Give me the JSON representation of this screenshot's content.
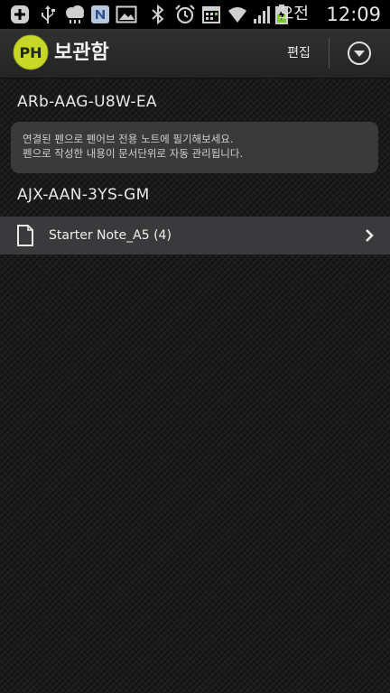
{
  "status_bar": {
    "ampm": "오전",
    "time": "12:09",
    "icons": [
      "add-icon",
      "usb-icon",
      "weather-icon",
      "n-app-icon",
      "gallery-icon",
      "bluetooth-icon",
      "alarm-icon",
      "calendar-icon",
      "wifi-icon",
      "signal-icon",
      "battery-charging-icon"
    ]
  },
  "action_bar": {
    "logo_text": "PH",
    "title": "보관함",
    "edit_label": "편집",
    "menu_icon": "dropdown-circle-icon"
  },
  "devices": [
    {
      "id_label": "ARb-AAG-U8W-EA",
      "hint_lines": [
        "연결된 펜으로 펜어브 전용 노트에 필기해보세요.",
        "펜으로 작성한 내용이 문서단위로 자동 관리됩니다."
      ]
    },
    {
      "id_label": "AJX-AAN-3YS-GM",
      "notes": [
        {
          "label": "Starter Note_A5 (4)",
          "icon": "document-icon",
          "chevron": "chevron-right-icon"
        }
      ]
    }
  ],
  "colors": {
    "logo_yellow": "#c8d826",
    "background": "#1b1b1b",
    "row_highlight": "#3a3a3c",
    "battery_green": "#7ec832"
  }
}
